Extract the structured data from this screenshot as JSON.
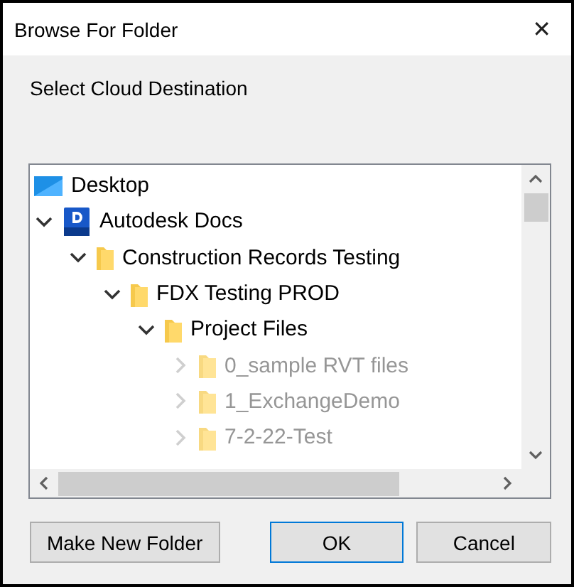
{
  "window": {
    "title": "Browse For Folder",
    "close": "✕"
  },
  "prompt": "Select Cloud Destination",
  "tree": [
    {
      "label": "Desktop",
      "kind": "desktop",
      "expandable": false
    },
    {
      "label": "Autodesk Docs",
      "kind": "docs",
      "expandable": true,
      "expanded": true,
      "blurred": false,
      "children": [
        {
          "label": "Construction Records Testing",
          "kind": "folder",
          "expandable": true,
          "expanded": true,
          "blurred": false,
          "children": [
            {
              "label": "FDX Testing PROD",
              "kind": "folder",
              "expandable": true,
              "expanded": true,
              "blurred": false,
              "children": [
                {
                  "label": "Project Files",
                  "kind": "folder",
                  "expandable": true,
                  "expanded": true,
                  "blurred": false,
                  "children": [
                    {
                      "label": "0_sample RVT files",
                      "kind": "folder",
                      "expandable": true,
                      "expanded": false,
                      "blurred": true
                    },
                    {
                      "label": "1_ExchangeDemo",
                      "kind": "folder",
                      "expandable": true,
                      "expanded": false,
                      "blurred": true
                    },
                    {
                      "label": "7-2-22-Test",
                      "kind": "folder",
                      "expandable": true,
                      "expanded": false,
                      "blurred": true
                    }
                  ]
                }
              ]
            }
          ]
        }
      ]
    }
  ],
  "buttons": [
    {
      "label": "Make New Folder",
      "default": false
    },
    {
      "label": "OK",
      "default": true
    },
    {
      "label": "Cancel",
      "default": false
    }
  ]
}
